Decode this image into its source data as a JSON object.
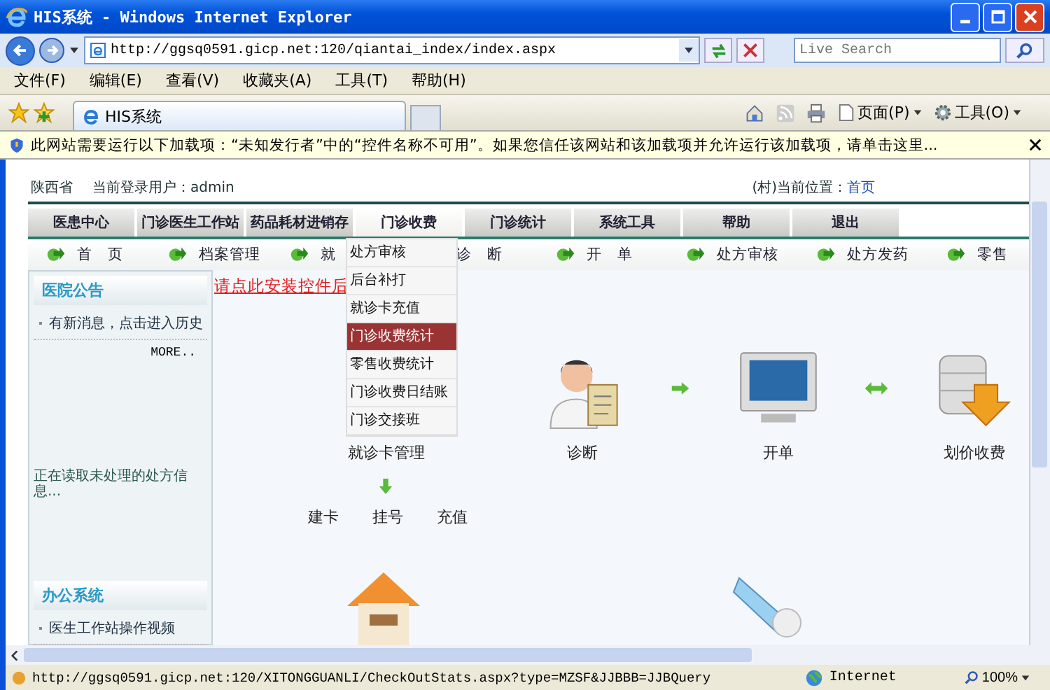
{
  "window": {
    "title": "HIS系统 - Windows Internet Explorer"
  },
  "address_bar": {
    "url": "http://ggsq0591.gicp.net:120/qiantai_index/index.aspx"
  },
  "search": {
    "placeholder": "Live Search"
  },
  "menu_bar": [
    "文件(F)",
    "编辑(E)",
    "查看(V)",
    "收藏夹(A)",
    "工具(T)",
    "帮助(H)"
  ],
  "tabs": [
    {
      "label": "HIS系统",
      "selected": true
    }
  ],
  "command_bar": [
    {
      "label": "页面(P)",
      "kind": "page"
    },
    {
      "label": "工具(O)",
      "kind": "tools"
    }
  ],
  "info_bar": {
    "message": "此网站需要运行以下加载项：“未知发行者”中的“控件名称不可用”。如果您信任该网站和该加载项并允许运行该加载项，请单击这里..."
  },
  "page": {
    "province": "陕西省",
    "user_label": "当前登录用户：",
    "user": "admin",
    "location_label": "(村)当前位置：",
    "location": "首页",
    "main_nav": [
      {
        "label": "医患中心",
        "selected": false
      },
      {
        "label": "门诊医生工作站",
        "selected": false
      },
      {
        "label": "药品耗材进销存",
        "selected": false
      },
      {
        "label": "门诊收费",
        "selected": true
      },
      {
        "label": "门诊统计",
        "selected": false
      },
      {
        "label": "系统工具",
        "selected": false
      },
      {
        "label": "帮助",
        "selected": false
      },
      {
        "label": "退出",
        "selected": false
      }
    ],
    "sub_nav": [
      "首　页",
      "档案管理",
      "就",
      "诊　断",
      "开　单",
      "处方审核",
      "处方发药",
      "零售"
    ],
    "dropdown": [
      {
        "label": "处方审核",
        "selected": false
      },
      {
        "label": "后台补打",
        "selected": false
      },
      {
        "label": "就诊卡充值",
        "selected": false
      },
      {
        "label": "门诊收费统计",
        "selected": true
      },
      {
        "label": "零售收费统计",
        "selected": false
      },
      {
        "label": "门诊收费日结账",
        "selected": false
      },
      {
        "label": "门诊交接班",
        "selected": false
      }
    ],
    "sidebar": {
      "notice_title": "医院公告",
      "notice_item": "有新消息，点击进入历史",
      "more": "MORE..",
      "loading": "正在读取未处理的处方信息...",
      "office_title": "办公系统",
      "office_item": "医生工作站操作视频"
    },
    "install_link": "请点此安装控件后",
    "flow": [
      {
        "label": "就诊卡管理",
        "kind": "card"
      },
      {
        "label": "诊断",
        "kind": "doctor"
      },
      {
        "label": "开单",
        "kind": "monitor"
      },
      {
        "label": "划价收费",
        "kind": "database"
      }
    ],
    "connectors": [
      {
        "kind": "right"
      },
      {
        "kind": "both"
      }
    ],
    "card_steps": [
      "建卡",
      "挂号",
      "充值"
    ]
  },
  "status_bar": {
    "url": "http://ggsq0591.gicp.net:120/XITONGGUANLI/CheckOutStats.aspx?type=MZSF&JJBBB=JJBQuery",
    "zone": "Internet",
    "zoom": "100%"
  }
}
